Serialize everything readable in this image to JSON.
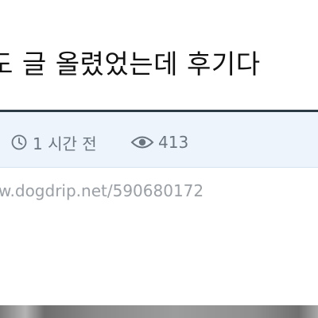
{
  "post": {
    "title": "도 글 올렸었는데 후기다",
    "time_ago": "1 시간 전",
    "views": "413",
    "url": "w.dogdrip.net/590680172"
  },
  "icons": {
    "time": "clock-icon",
    "views": "eye-icon"
  },
  "colors": {
    "meta_background": "#eef4fb",
    "meta_border": "#2b3a44",
    "meta_text": "#6b7580",
    "url_text": "#9aa0a6",
    "title_text": "#111111"
  }
}
